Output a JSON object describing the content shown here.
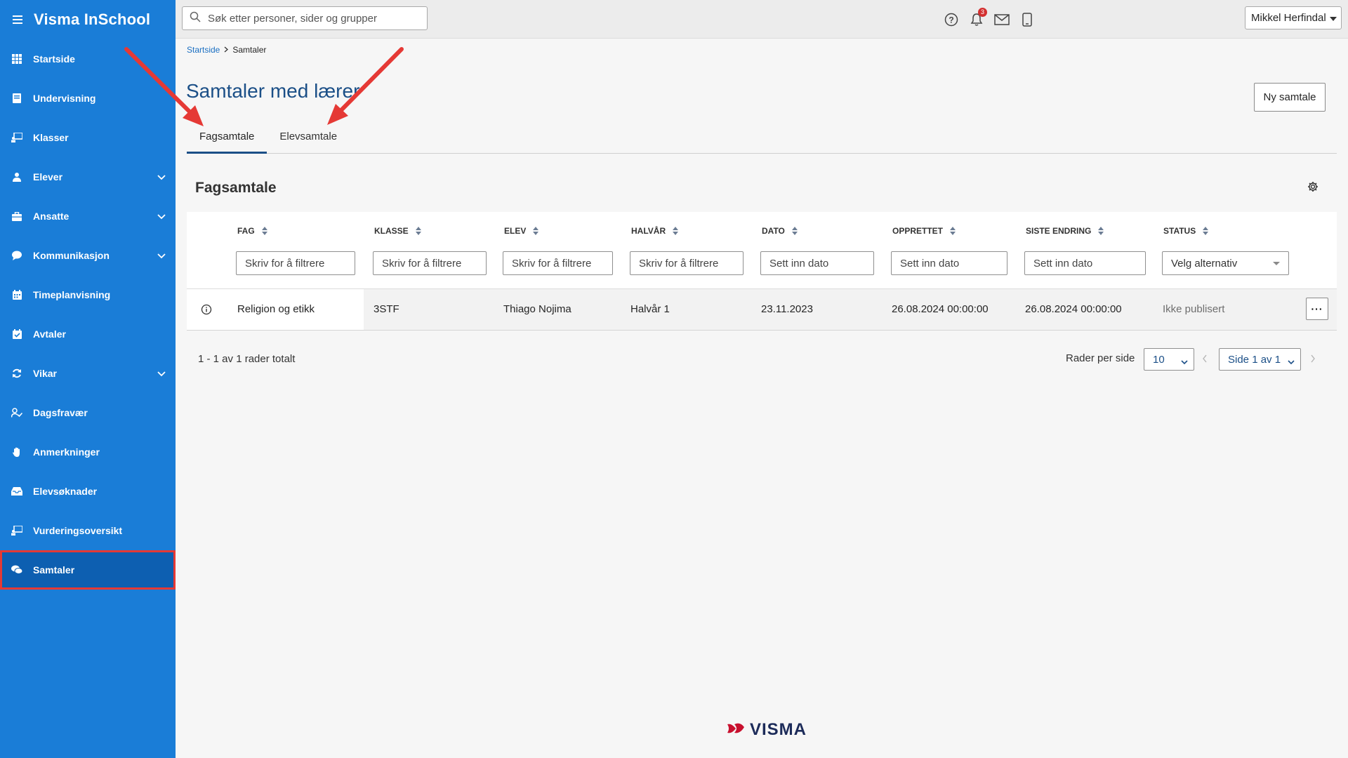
{
  "app": {
    "title": "Visma InSchool"
  },
  "sidebar": {
    "items": [
      {
        "label": "Startside",
        "icon": "grid-icon",
        "expandable": false
      },
      {
        "label": "Undervisning",
        "icon": "book-icon",
        "expandable": false
      },
      {
        "label": "Klasser",
        "icon": "classroom-icon",
        "expandable": false
      },
      {
        "label": "Elever",
        "icon": "student-icon",
        "expandable": true
      },
      {
        "label": "Ansatte",
        "icon": "briefcase-icon",
        "expandable": true
      },
      {
        "label": "Kommunikasjon",
        "icon": "chat-bubble-icon",
        "expandable": true
      },
      {
        "label": "Timeplanvisning",
        "icon": "calendar-icon",
        "expandable": false
      },
      {
        "label": "Avtaler",
        "icon": "calendar-check-icon",
        "expandable": false
      },
      {
        "label": "Vikar",
        "icon": "refresh-icon",
        "expandable": true
      },
      {
        "label": "Dagsfravær",
        "icon": "person-check-icon",
        "expandable": false
      },
      {
        "label": "Anmerkninger",
        "icon": "hand-icon",
        "expandable": false
      },
      {
        "label": "Elevsøknader",
        "icon": "inbox-icon",
        "expandable": false
      },
      {
        "label": "Vurderingsoversikt",
        "icon": "presentation-icon",
        "expandable": false
      },
      {
        "label": "Samtaler",
        "icon": "chats-icon",
        "expandable": false,
        "active": true
      }
    ]
  },
  "topbar": {
    "search_placeholder": "Søk etter personer, sider og grupper",
    "notifications_count": "3",
    "user_name": "Mikkel Herfindal"
  },
  "breadcrumb": {
    "home": "Startside",
    "current": "Samtaler"
  },
  "page": {
    "title": "Samtaler med lærer",
    "new_button": "Ny samtale",
    "tabs": [
      {
        "label": "Fagsamtale",
        "active": true
      },
      {
        "label": "Elevsamtale",
        "active": false
      }
    ],
    "section_title": "Fagsamtale"
  },
  "table": {
    "columns": [
      {
        "label": "FAG",
        "filter": "Skriv for å filtrere",
        "type": "text"
      },
      {
        "label": "KLASSE",
        "filter": "Skriv for å filtrere",
        "type": "text"
      },
      {
        "label": "ELEV",
        "filter": "Skriv for å filtrere",
        "type": "text"
      },
      {
        "label": "HALVÅR",
        "filter": "Skriv for å filtrere",
        "type": "text"
      },
      {
        "label": "DATO",
        "filter": "Sett inn dato",
        "type": "date"
      },
      {
        "label": "OPPRETTET",
        "filter": "Sett inn dato",
        "type": "date"
      },
      {
        "label": "SISTE ENDRING",
        "filter": "Sett inn dato",
        "type": "date"
      },
      {
        "label": "STATUS",
        "filter": "Velg alternativ",
        "type": "select"
      }
    ],
    "rows": [
      [
        "Religion og etikk",
        "3STF",
        "Thiago Nojima",
        "Halvår 1",
        "23.11.2023",
        "26.08.2024 00:00:00",
        "26.08.2024 00:00:00",
        "Ikke publisert"
      ]
    ],
    "more_label": "···"
  },
  "pagination": {
    "total": "1 - 1 av 1 rader totalt",
    "rows_per_page_label": "Rader per side",
    "rows_per_page": "10",
    "page": "Side 1 av 1"
  },
  "footer": {
    "logo_text": "VISMA"
  },
  "colors": {
    "sidebar": "#1a7dd7",
    "sidebar_active": "#0d5fb1",
    "title": "#1b4f87",
    "annotation": "#e53935",
    "badge": "#d32f2f"
  }
}
